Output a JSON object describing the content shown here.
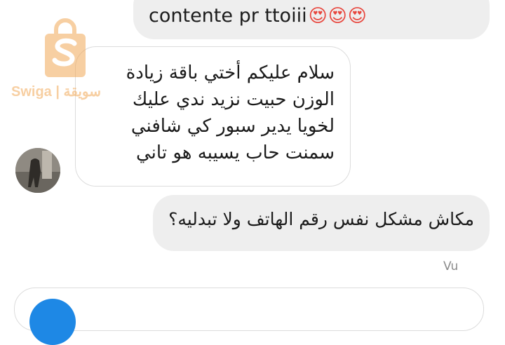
{
  "messages": [
    {
      "text": "contente pr ttoiii",
      "emoji": "😍😍😍"
    },
    {
      "lines": [
        "سلام عليكم أختي باقة زيادة",
        "الوزن حبيت نزيد ندي عليك",
        "لخويا يدير سبور كي شافني",
        "سمنت حاب يسيبه هو تاني"
      ]
    },
    {
      "text": "مكاش مشكل نفس رقم الهاتف ولا تبدليه؟"
    }
  ],
  "status": {
    "seen": "Vu"
  },
  "watermark": {
    "text": "Swiga | سويقة"
  },
  "colors": {
    "accent": "#1e88e5",
    "watermark": "#f2a857",
    "bubble_gray": "#eeeeee"
  }
}
